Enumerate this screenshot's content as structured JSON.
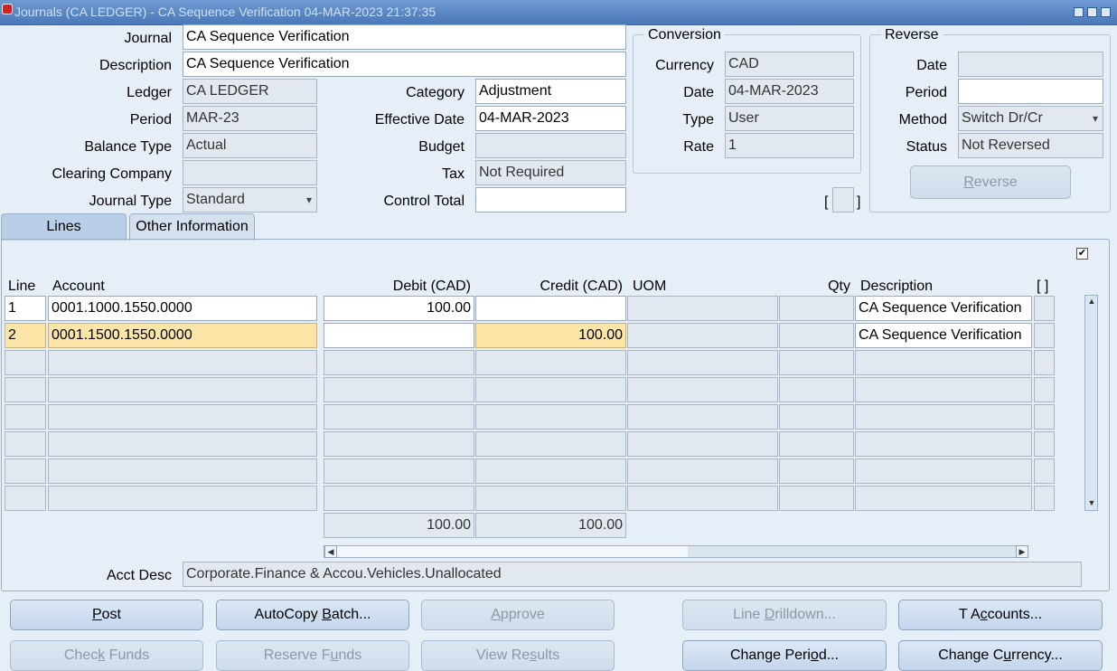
{
  "window": {
    "title": "Journals (CA LEDGER) - CA Sequence Verification 04-MAR-2023 21:37:35"
  },
  "header": {
    "journal_label": "Journal",
    "journal_value": "CA Sequence Verification",
    "description_label": "Description",
    "description_value": "CA Sequence Verification",
    "ledger_label": "Ledger",
    "ledger_value": "CA LEDGER",
    "period_label": "Period",
    "period_value": "MAR-23",
    "balance_type_label": "Balance Type",
    "balance_type_value": "Actual",
    "clearing_company_label": "Clearing Company",
    "clearing_company_value": "",
    "journal_type_label": "Journal Type",
    "journal_type_value": "Standard",
    "category_label": "Category",
    "category_value": "Adjustment",
    "effective_date_label": "Effective Date",
    "effective_date_value": "04-MAR-2023",
    "budget_label": "Budget",
    "budget_value": "",
    "tax_label": "Tax",
    "tax_value": "Not Required",
    "control_total_label": "Control Total",
    "control_total_value": ""
  },
  "conversion": {
    "title": "Conversion",
    "currency_label": "Currency",
    "currency_value": "CAD",
    "date_label": "Date",
    "date_value": "04-MAR-2023",
    "type_label": "Type",
    "type_value": "User",
    "rate_label": "Rate",
    "rate_value": "1",
    "bracket_left": "[",
    "bracket_right": "]"
  },
  "reverse": {
    "title": "Reverse",
    "date_label": "Date",
    "date_value": "",
    "period_label": "Period",
    "period_value": "",
    "method_label": "Method",
    "method_value": "Switch Dr/Cr",
    "status_label": "Status",
    "status_value": "Not Reversed",
    "reverse_button_pre": "",
    "reverse_button_key": "R",
    "reverse_button_post": "everse"
  },
  "tabs": [
    {
      "label": "Lines",
      "active": true
    },
    {
      "label": "Other Information",
      "active": false
    }
  ],
  "lines": {
    "columns": {
      "line": "Line",
      "account": "Account",
      "debit": "Debit (CAD)",
      "credit": "Credit (CAD)",
      "uom": "UOM",
      "qty": "Qty",
      "description": "Description",
      "brackets": "[ ]"
    },
    "rows": [
      {
        "line": "1",
        "account": "0001.1000.1550.0000",
        "debit": "100.00",
        "credit": "",
        "uom": "",
        "qty": "",
        "description": "CA Sequence Verification"
      },
      {
        "line": "2",
        "account": "0001.1500.1550.0000",
        "debit": "",
        "credit": "100.00",
        "uom": "",
        "qty": "",
        "description": "CA Sequence Verification"
      },
      {
        "line": "",
        "account": "",
        "debit": "",
        "credit": "",
        "uom": "",
        "qty": "",
        "description": ""
      },
      {
        "line": "",
        "account": "",
        "debit": "",
        "credit": "",
        "uom": "",
        "qty": "",
        "description": ""
      },
      {
        "line": "",
        "account": "",
        "debit": "",
        "credit": "",
        "uom": "",
        "qty": "",
        "description": ""
      },
      {
        "line": "",
        "account": "",
        "debit": "",
        "credit": "",
        "uom": "",
        "qty": "",
        "description": ""
      },
      {
        "line": "",
        "account": "",
        "debit": "",
        "credit": "",
        "uom": "",
        "qty": "",
        "description": ""
      },
      {
        "line": "",
        "account": "",
        "debit": "",
        "credit": "",
        "uom": "",
        "qty": "",
        "description": ""
      }
    ],
    "total_debit": "100.00",
    "total_credit": "100.00",
    "acct_desc_label": "Acct Desc",
    "acct_desc_value": "Corporate.Finance & Accou.Vehicles.Unallocated"
  },
  "buttons": {
    "post": {
      "pre": "",
      "key": "P",
      "post": "ost",
      "enabled": true
    },
    "autocopy": {
      "pre": "AutoCopy ",
      "key": "B",
      "post": "atch...",
      "enabled": true
    },
    "approve": {
      "pre": "",
      "key": "A",
      "post": "pprove",
      "enabled": false
    },
    "line_drilldown": {
      "pre": "Line ",
      "key": "D",
      "post": "rilldown...",
      "enabled": false
    },
    "t_accounts": {
      "pre": "T A",
      "key": "c",
      "post": "counts...",
      "enabled": true
    },
    "check_funds": {
      "pre": "Chec",
      "key": "k",
      "post": " Funds",
      "enabled": false
    },
    "reserve_funds": {
      "pre": "Reserve F",
      "key": "u",
      "post": "nds",
      "enabled": false
    },
    "view_results": {
      "pre": "View Re",
      "key": "s",
      "post": "ults",
      "enabled": false
    },
    "change_period": {
      "pre": "Change Peri",
      "key": "o",
      "post": "d...",
      "enabled": true
    },
    "change_currency": {
      "pre": "Change C",
      "key": "u",
      "post": "rrency...",
      "enabled": true
    }
  },
  "colors": {
    "titlebar": "#4a78b8",
    "background": "#e6eef7",
    "highlight_row": "#fbe6a8",
    "readonly_field": "#e2e8ef"
  }
}
